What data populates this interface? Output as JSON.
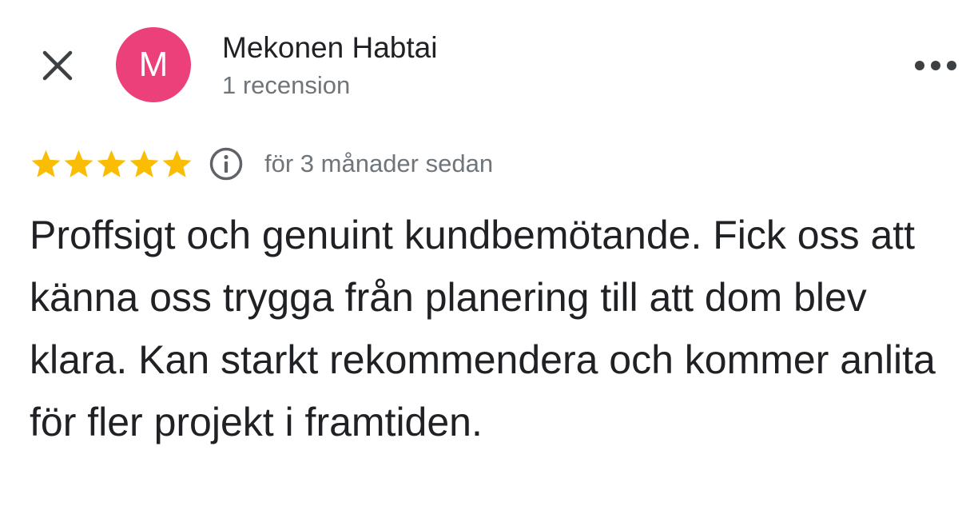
{
  "header": {
    "close_icon": "close-icon",
    "avatar_letter": "M",
    "avatar_color": "#ec407a",
    "author_name": "Mekonen Habtai",
    "review_count": "1 recension",
    "more_icon": "more-horizontal-icon"
  },
  "review": {
    "rating": 5,
    "max_rating": 5,
    "star_color": "#fbbc04",
    "info_icon": "info-icon",
    "time_ago": "för 3 månader sedan",
    "text": "Proffsigt och genuint kundbemötande. Fick oss att känna oss trygga från planering till att dom blev klara. Kan starkt rekommendera och kommer anlita för fler projekt i framtiden."
  }
}
